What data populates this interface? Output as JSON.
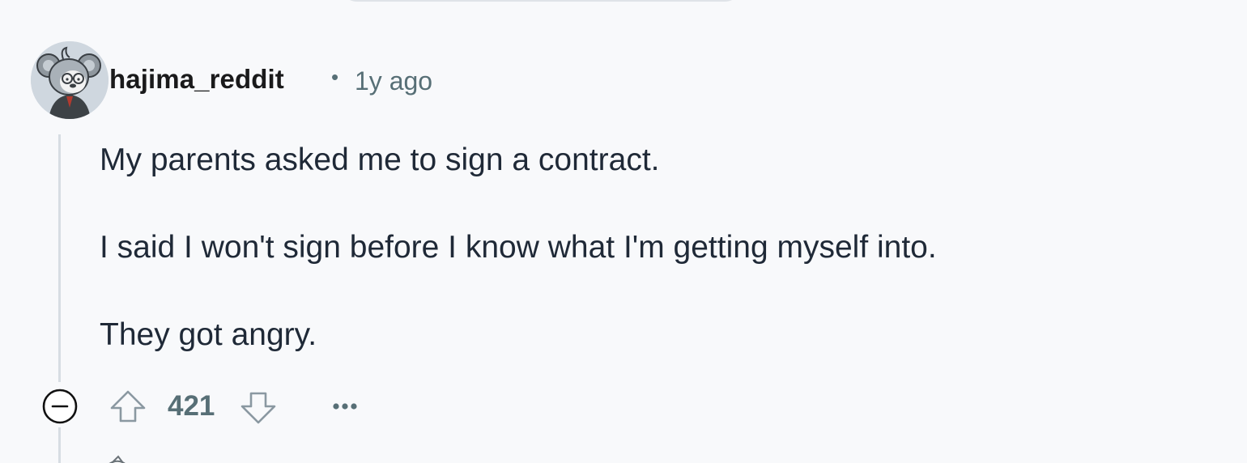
{
  "comment": {
    "author": "hajima_reddit",
    "separator": "•",
    "timestamp": "1y ago",
    "body": [
      "My parents asked me to sign a contract.",
      "I said I won't sign before I know what I'm getting myself into.",
      "They got angry."
    ],
    "score": "421"
  },
  "icons": {
    "avatar": "koala-avatar-icon",
    "collapse": "collapse-minus-circle-icon",
    "upvote": "arrow-up-outline-icon",
    "downvote": "arrow-down-outline-icon",
    "more": "ellipsis-horizontal-icon"
  },
  "colors": {
    "background": "#f8f9fb",
    "text": "#1f2937",
    "meta": "#576f76",
    "thread_line": "#d7dde3"
  }
}
